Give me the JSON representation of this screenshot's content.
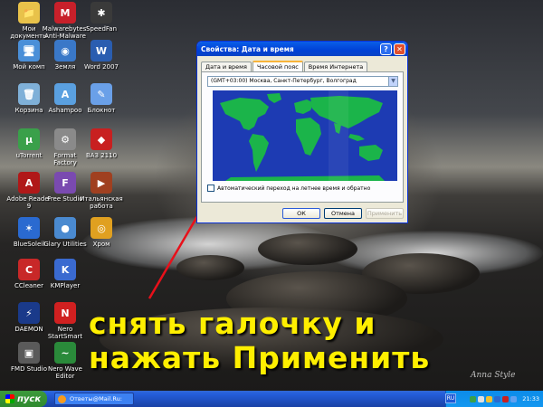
{
  "desktop_icons": [
    {
      "label": "Мои документы",
      "color": "#e8c24a",
      "glyph": "📁"
    },
    {
      "label": "Malwarebytes' Anti-Malware",
      "color": "#c8202a",
      "glyph": "M"
    },
    {
      "label": "SpeedFan",
      "color": "#3a3a3a",
      "glyph": "✱"
    },
    {
      "label": "Мой комп",
      "color": "#4a8fd8",
      "glyph": "🖥"
    },
    {
      "label": "Земля",
      "color": "#3a78c8",
      "glyph": "◉"
    },
    {
      "label": "Word 2007",
      "color": "#2a5db0",
      "glyph": "W"
    },
    {
      "label": "Корзина",
      "color": "#7fb0d8",
      "glyph": "🗑"
    },
    {
      "label": "Ashampoo",
      "color": "#5aa0e0",
      "glyph": "A"
    },
    {
      "label": "Блокнот",
      "color": "#6aa0e8",
      "glyph": "✎"
    },
    {
      "label": "uTorrent",
      "color": "#3aa04a",
      "glyph": "µ"
    },
    {
      "label": "Format Factory",
      "color": "#8a8a8a",
      "glyph": "⚙"
    },
    {
      "label": "ВАЗ 2110",
      "color": "#c82020",
      "glyph": "◆"
    },
    {
      "label": "Adobe Reader 9",
      "color": "#b01818",
      "glyph": "A"
    },
    {
      "label": "Free Studio",
      "color": "#7a4ab0",
      "glyph": "F"
    },
    {
      "label": "Итальянская работа",
      "color": "#a04020",
      "glyph": "▶"
    },
    {
      "label": "BlueSoleil",
      "color": "#2a6ad0",
      "glyph": "✶"
    },
    {
      "label": "Glary Utilities",
      "color": "#4a8ad0",
      "glyph": "●"
    },
    {
      "label": "Хром",
      "color": "#e0a020",
      "glyph": "◎"
    },
    {
      "label": "CCleaner",
      "color": "#c82828",
      "glyph": "C"
    },
    {
      "label": "KMPlayer",
      "color": "#3a6ad0",
      "glyph": "K"
    },
    {
      "label": "DAEMON",
      "color": "#1a3a8a",
      "glyph": "⚡"
    },
    {
      "label": "Nero StartSmart",
      "color": "#d02020",
      "glyph": "N"
    },
    {
      "label": "FMD Studio",
      "color": "#5a5a5a",
      "glyph": "▣"
    },
    {
      "label": "Nero Wave Editor",
      "color": "#2a8a3a",
      "glyph": "~"
    }
  ],
  "dialog": {
    "title": "Свойства: Дата и время",
    "help_glyph": "?",
    "close_glyph": "✕",
    "tabs": [
      {
        "label": "Дата и время",
        "active": false
      },
      {
        "label": "Часовой пояс",
        "active": true
      },
      {
        "label": "Время Интернета",
        "active": false
      }
    ],
    "timezone_value": "(GMT+03:00) Москва, Санкт-Петербург, Волгоград",
    "dst_checkbox_label": "Автоматический переход на летнее время и обратно",
    "dst_checked": false,
    "ok_label": "ОК",
    "cancel_label": "Отмена",
    "apply_label": "Применить"
  },
  "overlay": {
    "line1": "снять галочку и",
    "line2": "нажать Применить",
    "color": "#ffef00"
  },
  "taskbar": {
    "start_label": "пуск",
    "task_label": "Ответы@Mail.Ru: К...",
    "lang": "RU",
    "clock": "21:33"
  },
  "signature": "Anna Style"
}
